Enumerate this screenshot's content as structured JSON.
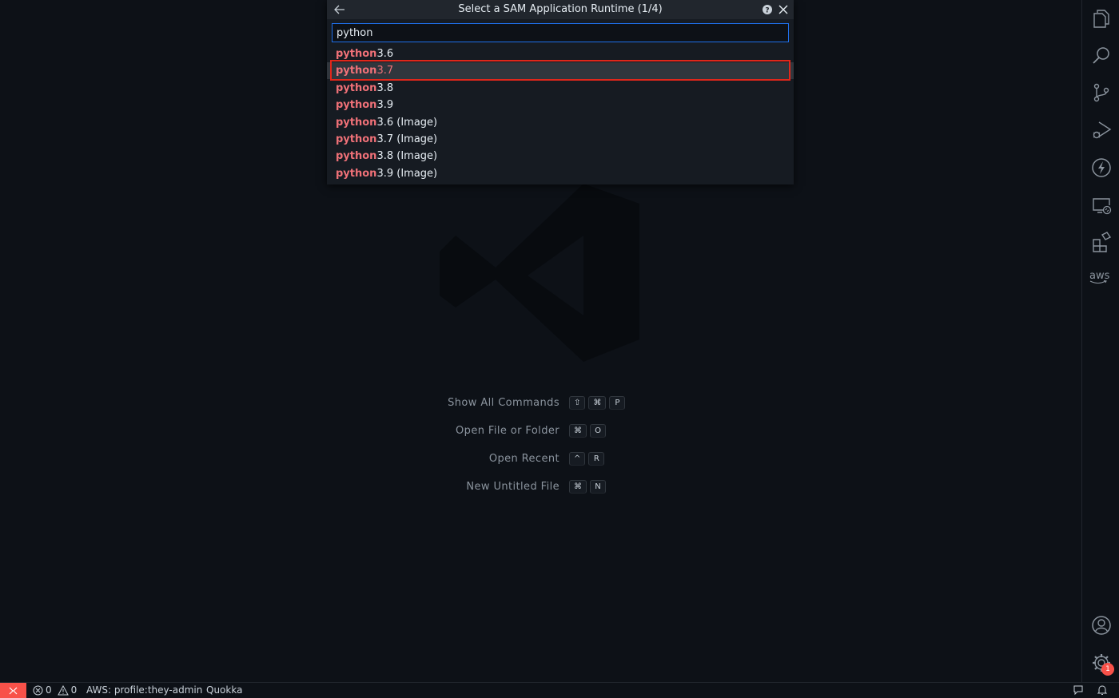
{
  "quickpick": {
    "title": "Select a SAM Application Runtime (1/4)",
    "input_value": "python",
    "items": [
      {
        "match": "python",
        "rest": "3.6"
      },
      {
        "match": "python",
        "rest": "3.7"
      },
      {
        "match": "python",
        "rest": "3.8"
      },
      {
        "match": "python",
        "rest": "3.9"
      },
      {
        "match": "python",
        "rest": "3.6 (Image)"
      },
      {
        "match": "python",
        "rest": "3.7 (Image)"
      },
      {
        "match": "python",
        "rest": "3.8 (Image)"
      },
      {
        "match": "python",
        "rest": "3.9 (Image)"
      }
    ]
  },
  "welcome": {
    "shortcuts": [
      {
        "label": "Show All Commands",
        "keys": [
          "⇧",
          "⌘",
          "P"
        ]
      },
      {
        "label": "Open File or Folder",
        "keys": [
          "⌘",
          "O"
        ]
      },
      {
        "label": "Open Recent",
        "keys": [
          "^",
          "R"
        ]
      },
      {
        "label": "New Untitled File",
        "keys": [
          "⌘",
          "N"
        ]
      }
    ]
  },
  "activitybar": {
    "icons": [
      "files-icon",
      "search-icon",
      "source-control-icon",
      "run-debug-icon",
      "lightning-icon",
      "remote-explorer-icon",
      "extensions-icon"
    ],
    "aws_label": "aws",
    "settings_badge": "1"
  },
  "statusbar": {
    "errors": "0",
    "warnings": "0",
    "aws_profile": "AWS: profile:they-admin",
    "quokka": "Quokka"
  },
  "colors": {
    "accent_red": "#f85149",
    "highlight": "#f07178",
    "focus_blue": "#1f6feb"
  }
}
